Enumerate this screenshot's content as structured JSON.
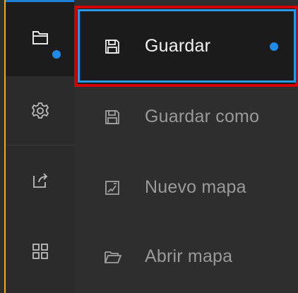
{
  "menu": {
    "items": [
      {
        "label": "Guardar",
        "icon": "save-icon",
        "state": "active"
      },
      {
        "label": "Guardar como",
        "icon": "save-as-icon",
        "state": "disabled"
      },
      {
        "label": "Nuevo mapa",
        "icon": "new-map-icon",
        "state": "disabled"
      },
      {
        "label": "Abrir mapa",
        "icon": "open-folder-icon",
        "state": "disabled"
      }
    ]
  },
  "rail": {
    "items": [
      {
        "icon": "folder-icon",
        "state": "active"
      },
      {
        "icon": "gear-icon"
      },
      {
        "icon": "share-icon"
      },
      {
        "icon": "apps-grid-icon"
      }
    ]
  },
  "colors": {
    "accent": "#1f8ae8",
    "focus_outer": "#d30000",
    "focus_inner": "#2a9ae6",
    "rail_accent": "#f0b000"
  }
}
